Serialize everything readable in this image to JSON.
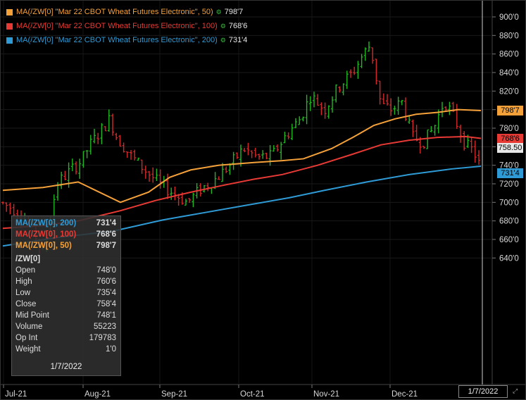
{
  "legend": [
    {
      "label": "MA(/ZW[0] \"Mar 22 CBOT Wheat Futures Electronic\", 50)",
      "value": "798'7",
      "color": "#f5a13a",
      "text_color": "#f5a13a"
    },
    {
      "label": "MA(/ZW[0] \"Mar 22 CBOT Wheat Futures Electronic\", 100)",
      "value": "768'6",
      "color": "#e83a34",
      "text_color": "#e83a34"
    },
    {
      "label": "MA(/ZW[0] \"Mar 22 CBOT Wheat Futures Electronic\", 200)",
      "value": "731'4",
      "color": "#2f9bd6",
      "text_color": "#2f9bd6"
    }
  ],
  "legend_icon": "chart-settings-icon",
  "tooltip": {
    "ma_rows": [
      {
        "label": "MA(/ZW[0], 200)",
        "value": "731'4",
        "color": "#2f9bd6"
      },
      {
        "label": "MA(/ZW[0], 100)",
        "value": "768'6",
        "color": "#e83a34"
      },
      {
        "label": "MA(/ZW[0], 50)",
        "value": "798'7",
        "color": "#f5a13a"
      }
    ],
    "symbol": "/ZW[0]",
    "rows": [
      {
        "label": "Open",
        "value": "748'0"
      },
      {
        "label": "High",
        "value": "760'6"
      },
      {
        "label": "Low",
        "value": "735'4"
      },
      {
        "label": "Close",
        "value": "758'4"
      },
      {
        "label": "Mid Point",
        "value": "748'1"
      },
      {
        "label": "Volume",
        "value": "55223"
      },
      {
        "label": "Op Int",
        "value": "179783"
      },
      {
        "label": "Weight",
        "value": "1'0"
      }
    ],
    "date": "1/7/2022"
  },
  "price_tags": [
    {
      "value": "798'7",
      "price": 798.875,
      "bg": "#f5a13a",
      "fg": "#000"
    },
    {
      "value": "768'6",
      "price": 768.75,
      "bg": "#e83a34",
      "fg": "#000"
    },
    {
      "value": "758.50",
      "price": 758.5,
      "bg": "#e6e6e6",
      "fg": "#000"
    },
    {
      "value": "731'4",
      "price": 731.5,
      "bg": "#2f9bd6",
      "fg": "#000"
    }
  ],
  "crosshair_date": "1/7/2022",
  "corner_icon": "expand-arrows-icon",
  "chart_data": {
    "type": "candlestick",
    "symbol": "/ZW[0]",
    "y_axis": {
      "min": 620,
      "max": 900,
      "ticks": [
        "640'0",
        "660'0",
        "680'0",
        "700'0",
        "720'0",
        "740'0",
        "760'0",
        "780'0",
        "800'0",
        "820'0",
        "840'0",
        "860'0",
        "880'0",
        "900'0"
      ],
      "tick_values": [
        640,
        660,
        680,
        700,
        720,
        740,
        760,
        780,
        800,
        820,
        840,
        860,
        880,
        900
      ]
    },
    "x_axis": {
      "labels": [
        "Jul-21",
        "Aug-21",
        "Sep-21",
        "Oct-21",
        "Nov-21",
        "Dec-21"
      ]
    },
    "colors": {
      "up": "#22b822",
      "down": "#d62828"
    },
    "grid": true
  }
}
